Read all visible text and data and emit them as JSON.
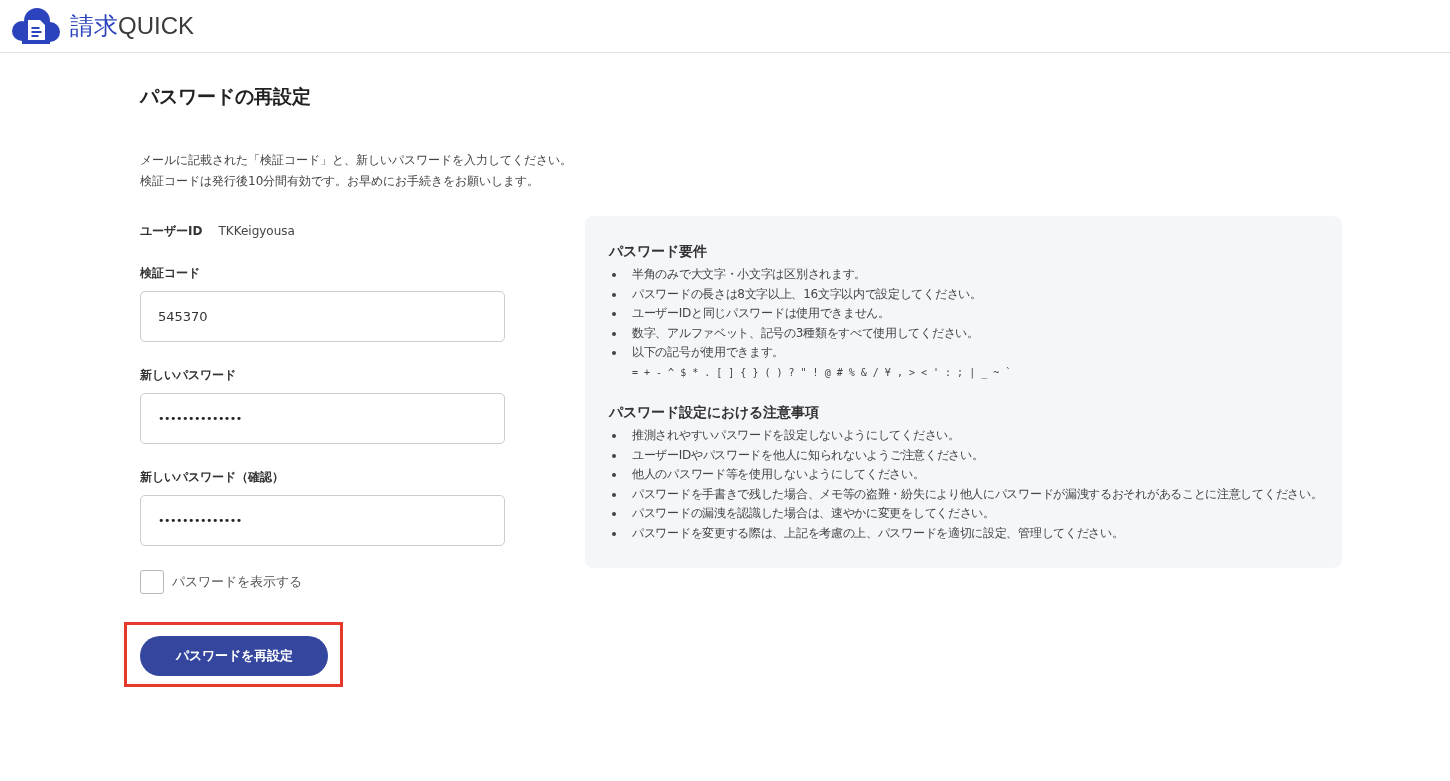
{
  "header": {
    "logo": {
      "kanji": "請求",
      "latin": "QUICK"
    }
  },
  "page": {
    "title": "パスワードの再設定",
    "description": [
      "メールに記載された「検証コード」と、新しいパスワードを入力してください。",
      "検証コードは発行後10分間有効です。お早めにお手続きをお願いします。"
    ],
    "user_id": {
      "label": "ユーザーID",
      "value": "TKKeigyousa"
    },
    "fields": [
      {
        "label": "検証コード",
        "kind": "text",
        "value": "545370"
      },
      {
        "label": "新しいパスワード",
        "kind": "password",
        "value": "••••••••••••••"
      },
      {
        "label": "新しいパスワード（確認）",
        "kind": "password",
        "value": "••••••••••••••"
      }
    ],
    "show_password": {
      "label": "パスワードを表示する",
      "checked": false
    },
    "submit_button": {
      "label": "パスワードを再設定",
      "highlighted": true
    }
  },
  "info_panel": {
    "sections": [
      {
        "title": "パスワード要件",
        "items": [
          {
            "text": "半角のみで大文字・小文字は区別されます。"
          },
          {
            "text": "パスワードの長さは8文字以上、16文字以内で設定してください。"
          },
          {
            "text": "ユーザーIDと同じパスワードは使用できません。"
          },
          {
            "text": "数字、アルファベット、記号の3種類をすべて使用してください。"
          },
          {
            "text": "以下の記号が使用できます。",
            "detail": "= + - ^ $ * . [ ] { } ( ) ? \" ! @ # % & / ¥ , > < ' : ; | _ ~ `"
          }
        ]
      },
      {
        "title": "パスワード設定における注意事項",
        "items": [
          {
            "text": "推測されやすいパスワードを設定しないようにしてください。"
          },
          {
            "text": "ユーザーIDやパスワードを他人に知られないようご注意ください。"
          },
          {
            "text": "他人のパスワード等を使用しないようにしてください。"
          },
          {
            "text": "パスワードを手書きで残した場合、メモ等の盗難・紛失により他人にパスワードが漏洩するおそれがあることに注意してください。"
          },
          {
            "text": "パスワードの漏洩を認識した場合は、速やかに変更をしてください。"
          },
          {
            "text": "パスワードを変更する際は、上記を考慮の上、パスワードを適切に設定、管理してください。"
          }
        ]
      }
    ]
  }
}
